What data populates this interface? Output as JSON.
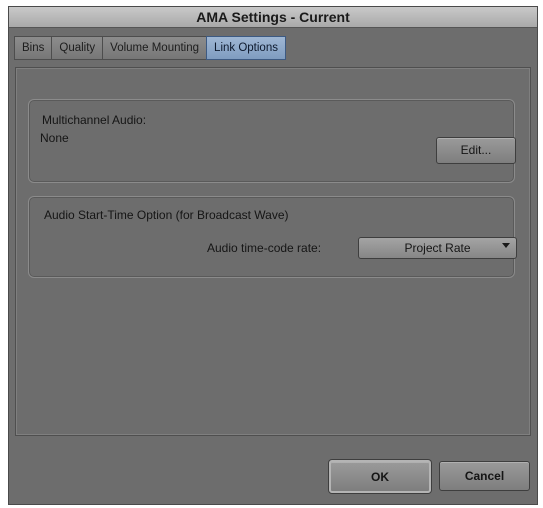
{
  "window": {
    "title": "AMA Settings - Current"
  },
  "tabs": [
    {
      "label": "Bins",
      "active": false
    },
    {
      "label": "Quality",
      "active": false
    },
    {
      "label": "Volume Mounting",
      "active": false
    },
    {
      "label": "Link Options",
      "active": true
    }
  ],
  "multichannel": {
    "label": "Multichannel Audio:",
    "value": "None",
    "edit_label": "Edit..."
  },
  "audio_start": {
    "title": "Audio Start-Time Option (for Broadcast Wave)",
    "rate_label": "Audio time-code rate:",
    "rate_value": "Project Rate"
  },
  "footer": {
    "ok_label": "OK",
    "cancel_label": "Cancel"
  },
  "colors": {
    "background": "#6d6d6d",
    "active_tab": "#8fa9cc",
    "title_bar": "#b9b9b9"
  }
}
